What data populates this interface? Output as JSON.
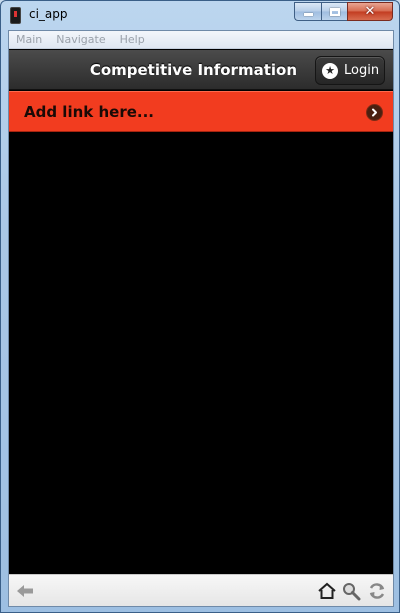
{
  "window": {
    "title": "ci_app",
    "buttons": {
      "minimize": "minimize",
      "maximize": "maximize",
      "close": "close"
    }
  },
  "menu": {
    "items": [
      "Main",
      "Navigate",
      "Help"
    ]
  },
  "header": {
    "title": "Competitive Information",
    "login_label": "Login"
  },
  "list": {
    "link_text": "Add link here..."
  },
  "colors": {
    "header_bg": "#333333",
    "link_row_bg": "#f23c1f",
    "content_bg": "#000000",
    "toolbar_bg": "#eeeeee"
  },
  "toolbar": {
    "icons": [
      "back-arrow-icon",
      "home-icon",
      "search-icon",
      "refresh-icon"
    ]
  }
}
